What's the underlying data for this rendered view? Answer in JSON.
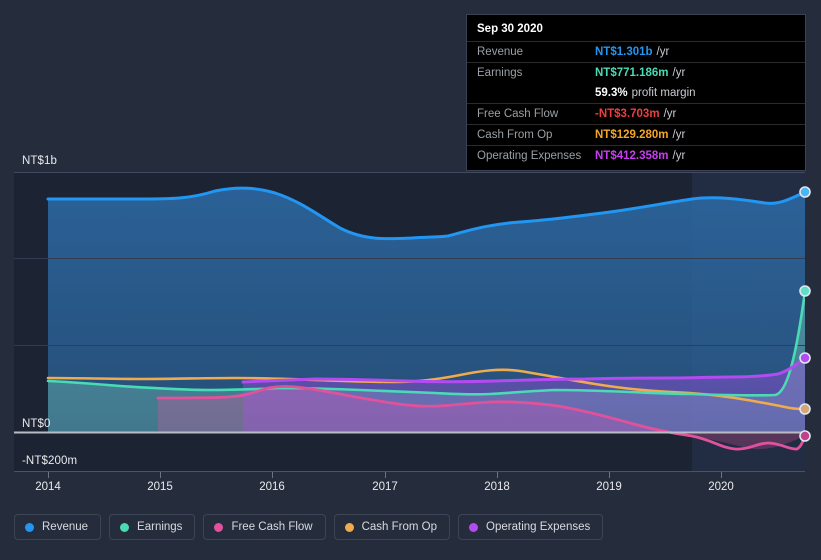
{
  "axes": {
    "y_ticks": [
      {
        "label": "NT$1b",
        "value": 1000
      },
      {
        "label": "NT$0",
        "value": 0
      },
      {
        "label": "-NT$200m",
        "value": -200
      }
    ],
    "x_ticks": [
      "2014",
      "2015",
      "2016",
      "2017",
      "2018",
      "2019",
      "2020"
    ]
  },
  "tooltip": {
    "title": "Sep 30 2020",
    "rows": [
      {
        "label": "Revenue",
        "value": "NT$1.301b",
        "unit": "/yr",
        "color": "#2196f3"
      },
      {
        "label": "Earnings",
        "value": "NT$771.186m",
        "unit": "/yr",
        "color": "#4adbb5"
      },
      {
        "label": "",
        "value": "59.3%",
        "unit": "profit margin",
        "color": "#ffffff"
      },
      {
        "label": "Free Cash Flow",
        "value": "-NT$3.703m",
        "unit": "/yr",
        "color": "#f03e3e"
      },
      {
        "label": "Cash From Op",
        "value": "NT$129.280m",
        "unit": "/yr",
        "color": "#f5a623"
      },
      {
        "label": "Operating Expenses",
        "value": "NT$412.358m",
        "unit": "/yr",
        "color": "#c93ef0"
      }
    ]
  },
  "legend": [
    {
      "label": "Revenue",
      "color": "#2196f3"
    },
    {
      "label": "Earnings",
      "color": "#4adbb5"
    },
    {
      "label": "Free Cash Flow",
      "color": "#e0529c"
    },
    {
      "label": "Cash From Op",
      "color": "#efab4d"
    },
    {
      "label": "Operating Expenses",
      "color": "#b24bf0"
    }
  ],
  "colors": {
    "background": "#252d3d",
    "plot_background": "#1c2333",
    "highlight_band": "#222c42",
    "gridline": "#3c4456",
    "zero_line": "#b9bcc4",
    "axis_text": "#e9eaec"
  },
  "chart_data": {
    "type": "area",
    "title": "",
    "xlabel": "",
    "ylabel": "",
    "ylim": [
      -200,
      1100
    ],
    "xlim": [
      "2013.8",
      "2020.9"
    ],
    "grid": true,
    "legend_position": "bottom-left",
    "units": "NT$ millions per year",
    "x": [
      2013.9,
      2014.25,
      2014.5,
      2014.75,
      2015.0,
      2015.25,
      2015.5,
      2015.75,
      2016.0,
      2016.25,
      2016.5,
      2016.75,
      2017.0,
      2017.25,
      2017.5,
      2017.75,
      2018.0,
      2018.25,
      2018.5,
      2018.75,
      2019.0,
      2019.25,
      2019.5,
      2019.75,
      2020.0,
      2020.25,
      2020.5,
      2020.75
    ],
    "series": [
      {
        "name": "Revenue",
        "color": "#2196f3",
        "start_x": 2013.9,
        "values": [
          905,
          905,
          905,
          903,
          900,
          905,
          925,
          942,
          945,
          940,
          930,
          905,
          865,
          830,
          800,
          790,
          795,
          815,
          855,
          870,
          868,
          865,
          880,
          900,
          920,
          940,
          935,
          1301
        ]
      },
      {
        "name": "Earnings",
        "color": "#4adbb5",
        "start_x": 2013.9,
        "values": [
          200,
          198,
          190,
          182,
          175,
          172,
          172,
          175,
          170,
          165,
          160,
          152,
          145,
          140,
          135,
          132,
          130,
          128,
          135,
          145,
          140,
          135,
          138,
          140,
          140,
          138,
          145,
          771
        ]
      },
      {
        "name": "Free Cash Flow",
        "color": "#e0529c",
        "start_x": 2014.95,
        "values": [
          null,
          null,
          null,
          null,
          108,
          108,
          108,
          110,
          112,
          120,
          135,
          140,
          135,
          128,
          118,
          112,
          105,
          100,
          95,
          88,
          80,
          60,
          30,
          0,
          -28,
          -20,
          -38,
          -4
        ]
      },
      {
        "name": "Cash From Op",
        "color": "#efab4d",
        "start_x": 2013.9,
        "values": [
          215,
          213,
          212,
          210,
          208,
          208,
          210,
          212,
          212,
          210,
          208,
          205,
          200,
          198,
          200,
          215,
          228,
          225,
          215,
          200,
          190,
          182,
          178,
          175,
          172,
          168,
          160,
          129
        ]
      },
      {
        "name": "Operating Expenses",
        "color": "#b24bf0",
        "start_x": 2015.75,
        "values": [
          null,
          null,
          null,
          null,
          null,
          null,
          null,
          205,
          208,
          210,
          212,
          212,
          210,
          208,
          207,
          206,
          206,
          208,
          210,
          211,
          212,
          212,
          213,
          214,
          215,
          216,
          230,
          412
        ]
      }
    ],
    "annotations": [
      {
        "type": "highlight_band",
        "from_x": 2019.85,
        "to_x": 2020.9
      },
      {
        "type": "endpoint_marker",
        "series": "Revenue",
        "x": 2020.75,
        "y": 1301
      },
      {
        "type": "endpoint_marker",
        "series": "Earnings",
        "x": 2020.75,
        "y": 771
      },
      {
        "type": "endpoint_marker",
        "series": "Operating Expenses",
        "x": 2020.75,
        "y": 412
      },
      {
        "type": "endpoint_marker",
        "series": "Cash From Op",
        "x": 2020.75,
        "y": 129
      },
      {
        "type": "endpoint_marker",
        "series": "Free Cash Flow",
        "x": 2020.75,
        "y": -4
      }
    ]
  }
}
